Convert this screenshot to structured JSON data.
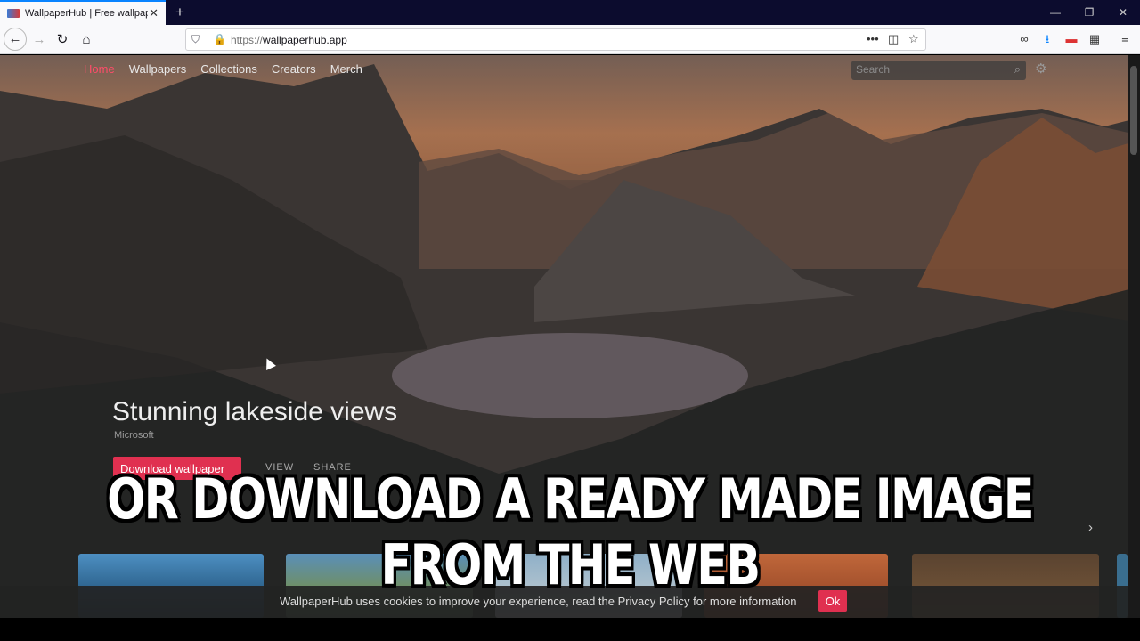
{
  "browser": {
    "tab_title": "WallpaperHub | Free wallpapers",
    "url_protocol": "https://",
    "url_host": "wallpaperhub.app",
    "url_more": "•••"
  },
  "site": {
    "nav": [
      "Home",
      "Wallpapers",
      "Collections",
      "Creators",
      "Merch"
    ],
    "active_nav": "Home",
    "search_placeholder": "Search"
  },
  "hero": {
    "title": "Stunning lakeside views",
    "author": "Microsoft",
    "download_label": "Download wallpaper",
    "view_label": "VIEW",
    "share_label": "SHARE"
  },
  "cookie_banner": {
    "message": "WallpaperHub uses cookies to improve your experience, read the Privacy Policy for more information",
    "ok_label": "Ok"
  },
  "caption": {
    "line1": "OR DOWNLOAD A READY MADE IMAGE",
    "line2": "FROM THE WEB"
  },
  "colors": {
    "accent": "#e03050",
    "active_nav": "#ff4d6a",
    "browser_accent": "#0a84ff"
  }
}
